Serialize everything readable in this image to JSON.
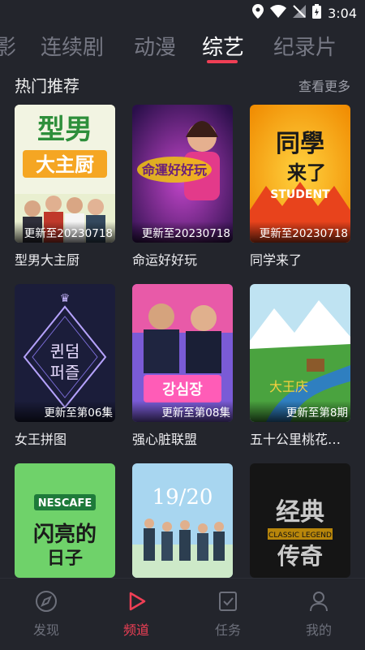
{
  "status_bar": {
    "time": "3:04"
  },
  "tabs": [
    {
      "label": "影"
    },
    {
      "label": "连续剧"
    },
    {
      "label": "动漫"
    },
    {
      "label": "综艺",
      "active": true
    },
    {
      "label": "纪录片"
    }
  ],
  "section": {
    "title": "热门推荐",
    "more": "查看更多"
  },
  "cards": [
    {
      "title": "型男大主厨",
      "badge": "更新至20230718",
      "poster_text": "型男 大主厨"
    },
    {
      "title": "命运好好玩",
      "badge": "更新至20230718",
      "poster_text": "命運好好玩"
    },
    {
      "title": "同学来了",
      "badge": "更新至20230718",
      "poster_text": "同學 来了 STUDENT"
    },
    {
      "title": "女王拼图",
      "badge": "更新至第06集",
      "poster_text": "퀸덤 퍼즐"
    },
    {
      "title": "强心脏联盟",
      "badge": "更新至第08集",
      "poster_text": "강심장 리그"
    },
    {
      "title": "五十公里桃花…",
      "badge": "更新至第8期",
      "poster_text": ""
    },
    {
      "title": "",
      "badge": "",
      "poster_text": "NESCAFE 闪亮的日子 Bling Bling de Time"
    },
    {
      "title": "",
      "badge": "",
      "poster_text": "19 20"
    },
    {
      "title": "",
      "badge": "",
      "poster_text": "经典 传奇 CLASSIC LEGEND"
    }
  ],
  "bottom_nav": [
    {
      "label": "发现",
      "icon": "compass-icon"
    },
    {
      "label": "频道",
      "icon": "play-icon",
      "active": true
    },
    {
      "label": "任务",
      "icon": "task-icon"
    },
    {
      "label": "我的",
      "icon": "user-icon"
    }
  ],
  "colors": {
    "accent": "#ef3f55",
    "background": "#23252c"
  }
}
